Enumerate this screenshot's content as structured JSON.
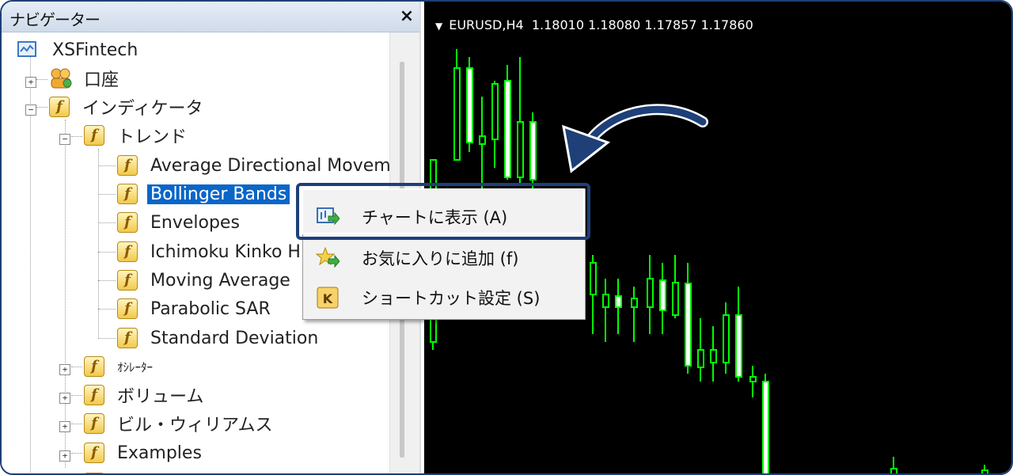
{
  "navigator": {
    "title": "ナビゲーター",
    "close_label": "×",
    "root": "XSFintech",
    "items": [
      {
        "label": "口座",
        "icon": "accounts-icon"
      },
      {
        "label": "インディケータ",
        "icon": "indicator-folder-icon"
      },
      {
        "label": "トレンド",
        "icon": "indicator-folder-icon"
      },
      {
        "label": "Average Directional Movem",
        "icon": "indicator-icon"
      },
      {
        "label": "Bollinger Bands",
        "icon": "indicator-icon",
        "selected": true
      },
      {
        "label": "Envelopes",
        "icon": "indicator-icon"
      },
      {
        "label": "Ichimoku Kinko H",
        "icon": "indicator-icon"
      },
      {
        "label": "Moving Average",
        "icon": "indicator-icon"
      },
      {
        "label": "Parabolic SAR",
        "icon": "indicator-icon"
      },
      {
        "label": "Standard Deviation",
        "icon": "indicator-icon"
      },
      {
        "label": "ｵｼﾚｰﾀｰ",
        "icon": "indicator-folder-icon"
      },
      {
        "label": "ボリューム",
        "icon": "indicator-folder-icon"
      },
      {
        "label": "ビル・ウィリアムス",
        "icon": "indicator-folder-icon"
      },
      {
        "label": "Examples",
        "icon": "examples-folder-icon"
      }
    ]
  },
  "chart": {
    "header": "EURUSD,H4  1.18010 1.18080 1.17857 1.17860",
    "background": "#000000",
    "candle_color": "#00ff00"
  },
  "context_menu": {
    "items": [
      {
        "label": "チャートに表示 (A)",
        "icon": "show-on-chart-icon",
        "highlighted": true
      },
      {
        "label": "お気に入りに追加 (f)",
        "icon": "add-favorite-icon"
      },
      {
        "label": "ショートカット設定 (S)",
        "icon": "shortcut-k-icon"
      }
    ]
  },
  "colors": {
    "accent": "#1e3f78",
    "selection": "#0a66c8",
    "candle_bull": "#00ff00"
  }
}
